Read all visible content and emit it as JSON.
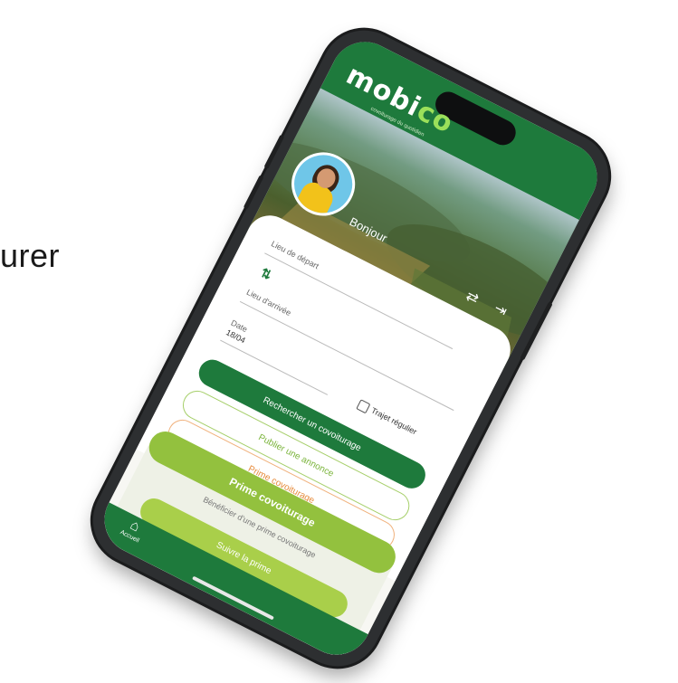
{
  "side_text": "urer",
  "app": {
    "logo_main": "mobi",
    "logo_eco": "co",
    "logo_tagline": "covoiturage du quotidien"
  },
  "profile": {
    "greeting": "Bonjour"
  },
  "search_form": {
    "departure_label": "Lieu de départ",
    "arrival_label": "Lieu d'arrivée",
    "date_label": "Date",
    "date_value": "18/04",
    "regular_trip_label": "Trajet régulier"
  },
  "buttons": {
    "search": "Rechercher un covoiturage",
    "publish": "Publier une annonce",
    "ideas": "Prime covoiturage"
  },
  "bonus_panel": {
    "title": "Prime covoiturage",
    "text": "Bénéficier d'une prime covoiturage",
    "button": "Suivre la prime"
  },
  "bottom_nav": {
    "home_label": "Accueil"
  },
  "colors": {
    "brand_green": "#1e7a3c",
    "lime": "#93c13e",
    "orange": "#e68a3a"
  },
  "icons": {
    "home": "home-icon",
    "swap": "swap-icon",
    "logout": "logout-icon",
    "switch": "toggle-icon"
  }
}
